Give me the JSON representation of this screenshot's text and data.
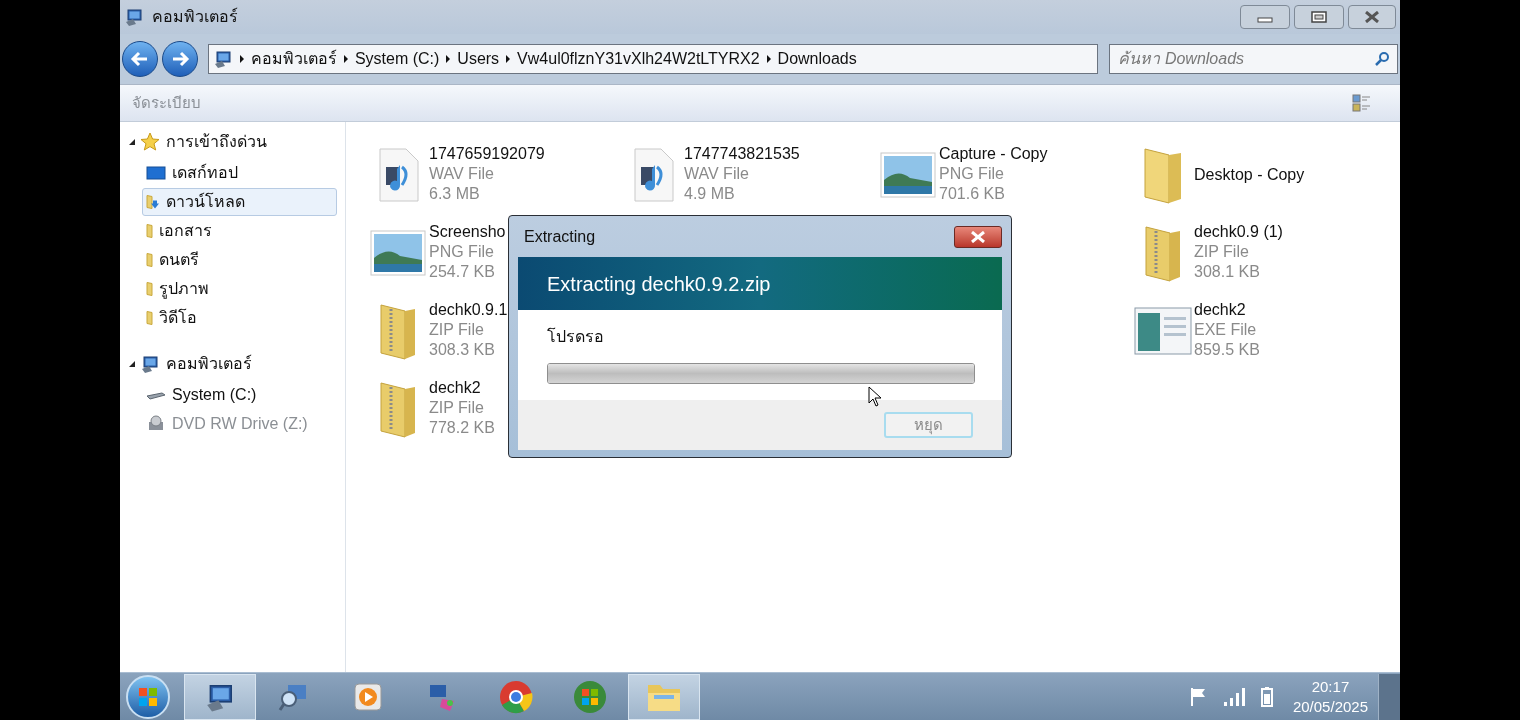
{
  "window": {
    "title": "คอมพิวเตอร์"
  },
  "address_bar": {
    "crumbs": [
      "คอมพิวเตอร์",
      "System (C:)",
      "Users",
      "Vw4ul0flznY31vXlh24W2tLTYRX2",
      "Downloads"
    ]
  },
  "search": {
    "placeholder": "ค้นหา Downloads"
  },
  "toolbar": {
    "organize": "จัดระเบียบ"
  },
  "sidebar": {
    "groups": [
      {
        "label": "การเข้าถึงด่วน",
        "kind": "favorites",
        "expanded": true,
        "children": [
          {
            "label": "เดสก์ทอป",
            "kind": "desktop",
            "selected": false,
            "disabled": false
          },
          {
            "label": "ดาวน์โหลด",
            "kind": "downloads",
            "selected": true,
            "disabled": false
          },
          {
            "label": "เอกสาร",
            "kind": "library",
            "selected": false,
            "disabled": false
          },
          {
            "label": "ดนตรี",
            "kind": "library",
            "selected": false,
            "disabled": false
          },
          {
            "label": "รูปภาพ",
            "kind": "library",
            "selected": false,
            "disabled": false
          },
          {
            "label": "วิดีโอ",
            "kind": "library",
            "selected": false,
            "disabled": false
          }
        ]
      },
      {
        "label": "คอมพิวเตอร์",
        "kind": "computer",
        "expanded": true,
        "children": [
          {
            "label": "System (C:)",
            "kind": "drive",
            "selected": false,
            "disabled": false
          },
          {
            "label": "DVD RW Drive (Z:)",
            "kind": "dvd",
            "selected": false,
            "disabled": true
          }
        ]
      }
    ]
  },
  "files": {
    "columns": [
      [
        {
          "name": "1747659192079",
          "kind": "wav",
          "type": "WAV File",
          "size": "6.3 MB"
        },
        {
          "name": "Screensho",
          "kind": "png",
          "type": "PNG File",
          "size": "254.7 KB"
        },
        {
          "name": "dechk0.9.1",
          "kind": "zip",
          "type": "ZIP File",
          "size": "308.3 KB"
        },
        {
          "name": "dechk2",
          "kind": "zip",
          "type": "ZIP File",
          "size": "778.2 KB"
        }
      ],
      [
        {
          "name": "1747743821535",
          "kind": "wav",
          "type": "WAV File",
          "size": "4.9 MB"
        }
      ],
      [
        {
          "name": "Capture - Copy",
          "kind": "png",
          "type": "PNG File",
          "size": "701.6 KB"
        }
      ],
      [
        {
          "name": "Desktop - Copy",
          "kind": "folder"
        },
        {
          "name": "dechk0.9 (1)",
          "kind": "zip",
          "type": "ZIP File",
          "size": "308.1 KB"
        },
        {
          "name": "dechk2",
          "kind": "exe",
          "type": "EXE File",
          "size": "859.5 KB"
        }
      ]
    ]
  },
  "dialog": {
    "title": "Extracting",
    "heading": "Extracting dechk0.9.2.zip",
    "message": "โปรดรอ",
    "progress": {
      "level": 1
    },
    "button": {
      "label": "หยุด",
      "disabled": true
    }
  },
  "taskbar": {
    "apps": [
      {
        "kind": "computer",
        "active": true
      },
      {
        "kind": "search",
        "active": false
      },
      {
        "kind": "media",
        "active": false
      },
      {
        "kind": "network",
        "active": false
      },
      {
        "kind": "browser",
        "active": false
      },
      {
        "kind": "windows",
        "active": false
      },
      {
        "kind": "folder",
        "active": true
      }
    ],
    "clock": {
      "time": "20:17",
      "date": "20/05/2025"
    }
  }
}
